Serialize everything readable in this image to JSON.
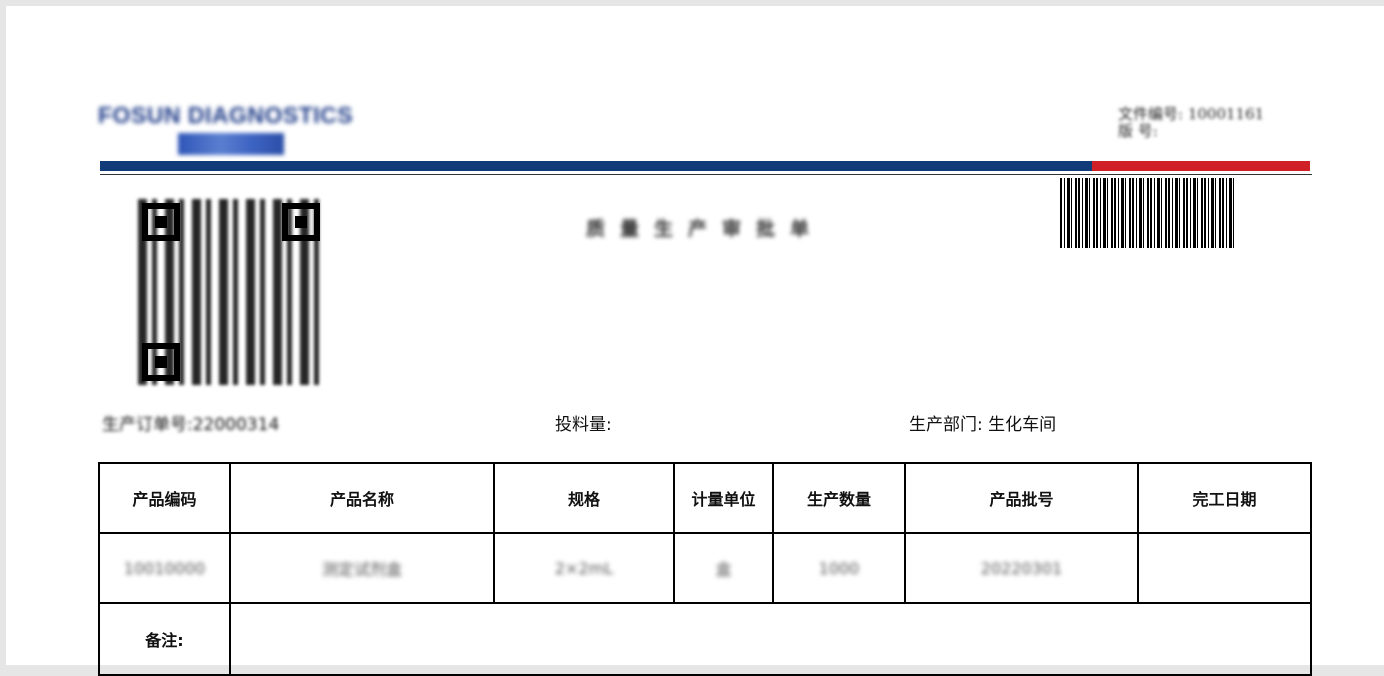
{
  "header": {
    "logo_text": "FOSUN DIAGNOSTICS",
    "doc_info_line1": "文件编号: 10001161",
    "doc_info_line2": "版    号: ",
    "rule_colors": {
      "blue": "#103a78",
      "red": "#cf2027"
    }
  },
  "title": "质量生产审批单",
  "meta": {
    "order_label": "生产订单号:22000314",
    "feed_label": "投料量:",
    "dept_label": "生产部门:",
    "dept_value": "生化车间"
  },
  "table": {
    "headers": [
      "产品编码",
      "产品名称",
      "规格",
      "计量单位",
      "生产数量",
      "产品批号",
      "完工日期"
    ],
    "row": [
      "10010000",
      "测定试剂盒",
      "2×2mL",
      "盒",
      "1000",
      "20220301",
      ""
    ],
    "note_label": "备注:"
  },
  "icons": {
    "qr": "qr-code-icon",
    "barcode": "barcode-icon"
  }
}
